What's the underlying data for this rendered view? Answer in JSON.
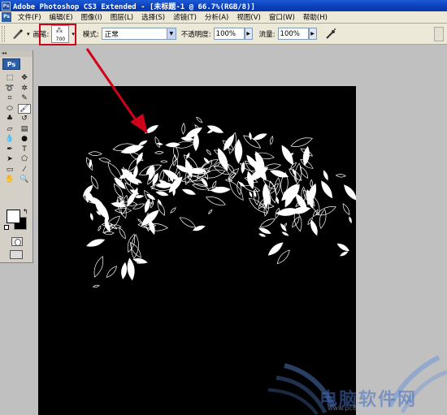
{
  "window": {
    "title": "Adobe Photoshop CS3 Extended - [未标题-1 @ 66.7%(RGB/8)]",
    "app_icon": "Ps"
  },
  "menu": {
    "logo": "Ps",
    "items": [
      "文件(F)",
      "编辑(E)",
      "图像(I)",
      "图层(L)",
      "选择(S)",
      "滤镜(T)",
      "分析(A)",
      "视图(V)",
      "窗口(W)",
      "帮助(H)"
    ]
  },
  "options": {
    "tool_icon": "brush-icon",
    "brush_label": "画笔:",
    "brush_size": "700",
    "mode_label": "模式:",
    "mode_value": "正常",
    "opacity_label": "不透明度:",
    "opacity_value": "100%",
    "flow_label": "流量:",
    "flow_value": "100%",
    "airbrush_icon": "airbrush-icon"
  },
  "toolbox": {
    "collapse": "◂◂",
    "logo": "Ps",
    "tools": [
      {
        "name": "marquee-icon",
        "glyph": "⬚"
      },
      {
        "name": "move-icon",
        "glyph": "✥"
      },
      {
        "name": "lasso-icon",
        "glyph": "➰"
      },
      {
        "name": "magic-wand-icon",
        "glyph": "✲"
      },
      {
        "name": "crop-icon",
        "glyph": "⌗"
      },
      {
        "name": "eyedropper-icon",
        "glyph": "✎"
      },
      {
        "name": "healing-brush-icon",
        "glyph": "⬭"
      },
      {
        "name": "brush-icon",
        "glyph": "🖌"
      },
      {
        "name": "clone-stamp-icon",
        "glyph": "♣"
      },
      {
        "name": "history-brush-icon",
        "glyph": "↺"
      },
      {
        "name": "eraser-icon",
        "glyph": "▱"
      },
      {
        "name": "gradient-icon",
        "glyph": "▤"
      },
      {
        "name": "blur-icon",
        "glyph": "💧"
      },
      {
        "name": "dodge-icon",
        "glyph": "●"
      },
      {
        "name": "pen-icon",
        "glyph": "✒"
      },
      {
        "name": "type-icon",
        "glyph": "T"
      },
      {
        "name": "path-selection-icon",
        "glyph": "➤"
      },
      {
        "name": "shape-icon",
        "glyph": "⬠"
      },
      {
        "name": "notes-icon",
        "glyph": "▭"
      },
      {
        "name": "eyedropper2-icon",
        "glyph": "⁄"
      },
      {
        "name": "hand-icon",
        "glyph": "✋"
      },
      {
        "name": "zoom-icon",
        "glyph": "🔍"
      }
    ],
    "swap_glyph": "↰"
  },
  "watermark": {
    "text": "电脑软件网",
    "url": "www.pc6.com"
  },
  "colors": {
    "highlight": "#d0021b",
    "canvas": "#000000",
    "titlebar": "#0b3fb6"
  }
}
